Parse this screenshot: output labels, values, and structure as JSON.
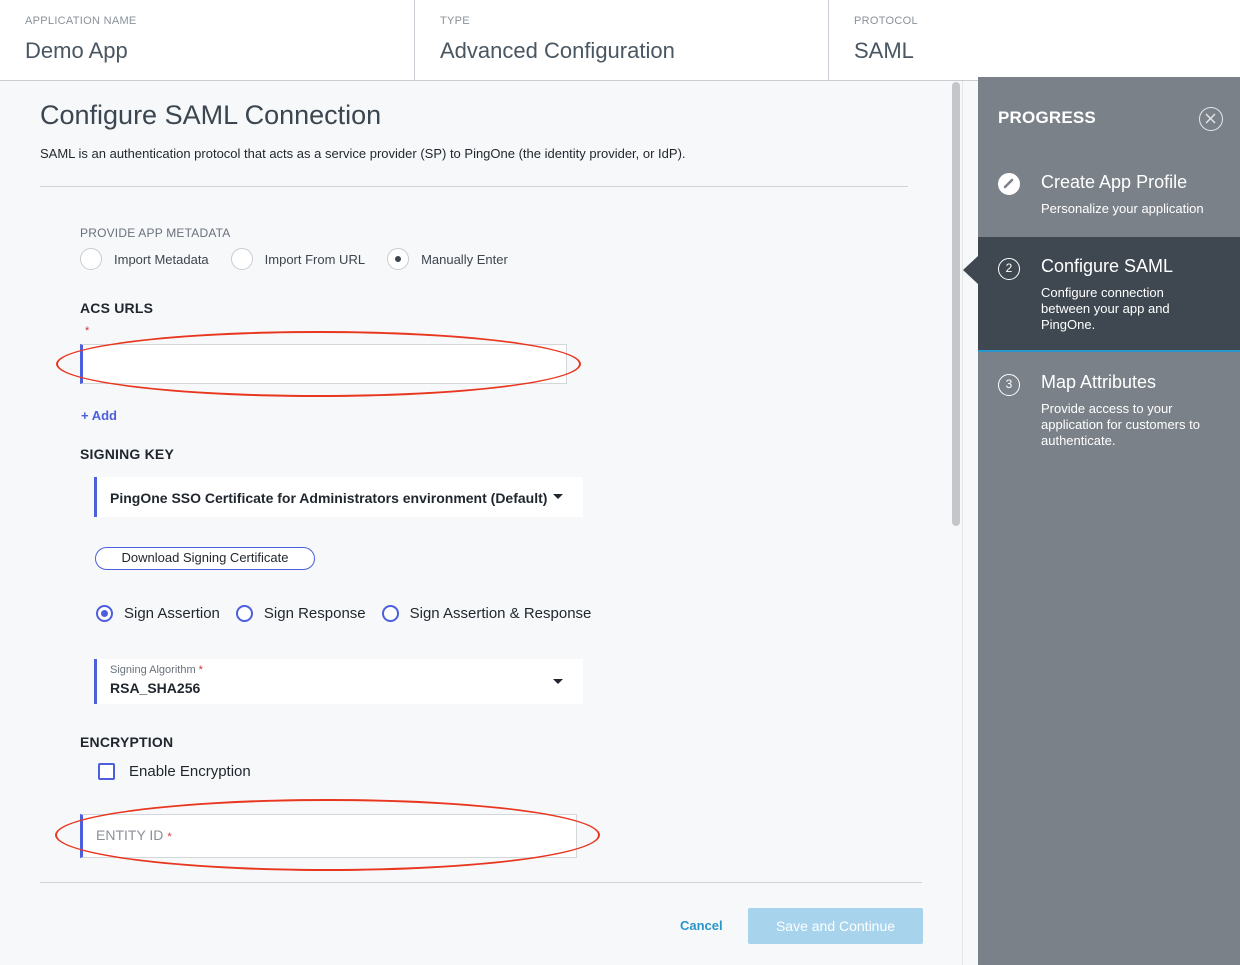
{
  "header": {
    "app_name_label": "APPLICATION NAME",
    "app_name_value": "Demo App",
    "type_label": "TYPE",
    "type_value": "Advanced Configuration",
    "protocol_label": "PROTOCOL",
    "protocol_value": "SAML"
  },
  "form": {
    "title": "Configure SAML Connection",
    "subtitle": "SAML is an authentication protocol that acts as a service provider (SP) to PingOne (the identity provider, or IdP).",
    "metadata_label": "PROVIDE APP METADATA",
    "metadata_options": [
      "Import Metadata",
      "Import From URL",
      "Manually Enter"
    ],
    "metadata_selected": "Manually Enter",
    "acs_label": "ACS URLS",
    "acs_required_mark": "*",
    "acs_value": "",
    "add_link": "+ Add",
    "signing_key_label": "SIGNING KEY",
    "signing_key_value": "PingOne SSO Certificate for Administrators environment (Default)",
    "download_button": "Download Signing Certificate",
    "sign_options": [
      "Sign Assertion",
      "Sign Response",
      "Sign Assertion & Response"
    ],
    "sign_selected": "Sign Assertion",
    "signing_algorithm_label": "Signing Algorithm",
    "signing_algorithm_required": "*",
    "signing_algorithm_value": "RSA_SHA256",
    "encryption_label": "ENCRYPTION",
    "enable_encryption_label": "Enable Encryption",
    "enable_encryption_checked": false,
    "entity_id_placeholder": "ENTITY ID",
    "entity_id_required": "*",
    "entity_id_value": ""
  },
  "footer": {
    "cancel": "Cancel",
    "save": "Save and Continue"
  },
  "progress": {
    "title": "PROGRESS",
    "steps": [
      {
        "icon": "pencil-icon",
        "title": "Create App Profile",
        "desc": "Personalize your application",
        "state": "done"
      },
      {
        "number": "2",
        "title": "Configure SAML",
        "desc": "Configure connection between your app and PingOne.",
        "state": "active"
      },
      {
        "number": "3",
        "title": "Map Attributes",
        "desc": "Provide access to your application for customers to authenticate.",
        "state": "upcoming"
      }
    ]
  },
  "colors": {
    "accent": "#4c5fdc",
    "link": "#2996cc",
    "save_disabled": "#a7d3ec",
    "side_panel": "#7a8189",
    "side_active": "#3f4850",
    "annotation": "#e8361f"
  }
}
